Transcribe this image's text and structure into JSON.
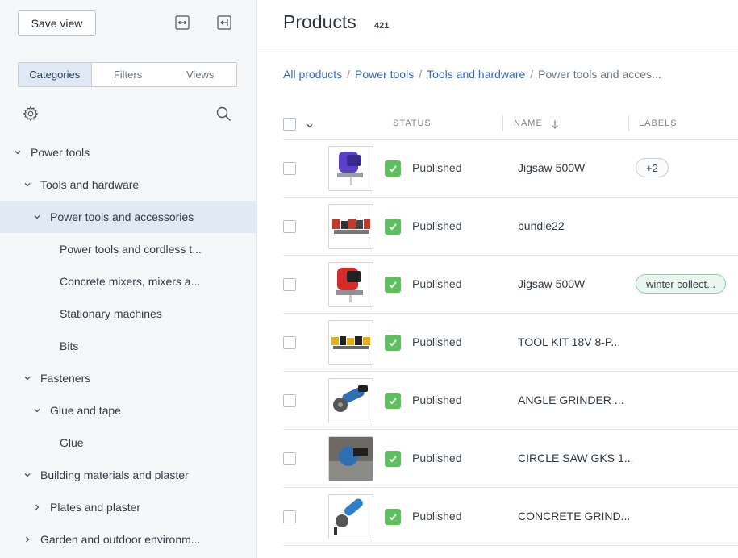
{
  "sidebar": {
    "save_view_label": "Save view",
    "tabs": [
      {
        "label": "Categories",
        "active": true
      },
      {
        "label": "Filters",
        "active": false
      },
      {
        "label": "Views",
        "active": false
      }
    ],
    "tree": [
      {
        "label": "Power tools",
        "level": 0,
        "chevron": "down",
        "selected": false
      },
      {
        "label": "Tools and hardware",
        "level": 1,
        "chevron": "down",
        "selected": false
      },
      {
        "label": "Power tools and accessories",
        "level": 2,
        "chevron": "down",
        "selected": true
      },
      {
        "label": "Power tools and cordless t...",
        "level": 3,
        "chevron": "none",
        "selected": false
      },
      {
        "label": "Concrete mixers, mixers a...",
        "level": 3,
        "chevron": "none",
        "selected": false
      },
      {
        "label": "Stationary machines",
        "level": 3,
        "chevron": "none",
        "selected": false
      },
      {
        "label": "Bits",
        "level": 3,
        "chevron": "none",
        "selected": false
      },
      {
        "label": "Fasteners",
        "level": 1,
        "chevron": "down",
        "selected": false
      },
      {
        "label": "Glue and tape",
        "level": 2,
        "chevron": "down",
        "selected": false
      },
      {
        "label": "Glue",
        "level": 3,
        "chevron": "none",
        "selected": false
      },
      {
        "label": "Building materials and plaster",
        "level": 1,
        "chevron": "down",
        "selected": false
      },
      {
        "label": "Plates and plaster",
        "level": 2,
        "chevron": "right",
        "selected": false
      },
      {
        "label": "Garden and outdoor environm...",
        "level": 1,
        "chevron": "right",
        "selected": false
      }
    ]
  },
  "header": {
    "title": "Products",
    "count": "421"
  },
  "breadcrumb": {
    "links": [
      "All products",
      "Power tools",
      "Tools and hardware"
    ],
    "current": "Power tools and acces...",
    "separator": "/"
  },
  "table": {
    "columns": {
      "status": "STATUS",
      "name": "NAME",
      "labels": "LABELS"
    },
    "rows": [
      {
        "status": "Published",
        "name": "Jigsaw 500W",
        "label": "+2",
        "label_style": "grey",
        "thumb": "jigsaw-purple"
      },
      {
        "status": "Published",
        "name": "bundle22",
        "label": "",
        "label_style": "",
        "thumb": "tool-bundle"
      },
      {
        "status": "Published",
        "name": "Jigsaw 500W",
        "label": "winter collect...",
        "label_style": "green",
        "thumb": "jigsaw-red"
      },
      {
        "status": "Published",
        "name": "TOOL KIT 18V 8-P...",
        "label": "",
        "label_style": "",
        "thumb": "tool-kit"
      },
      {
        "status": "Published",
        "name": "ANGLE GRINDER ...",
        "label": "",
        "label_style": "",
        "thumb": "angle-grinder"
      },
      {
        "status": "Published",
        "name": "CIRCLE SAW GKS 1...",
        "label": "",
        "label_style": "",
        "thumb": "circle-saw"
      },
      {
        "status": "Published",
        "name": "CONCRETE GRIND...",
        "label": "",
        "label_style": "",
        "thumb": "concrete-grinder"
      }
    ]
  },
  "colors": {
    "accent": "#3568b8",
    "selected_bg": "#e1e9f4",
    "published_green": "#5cc05c"
  }
}
